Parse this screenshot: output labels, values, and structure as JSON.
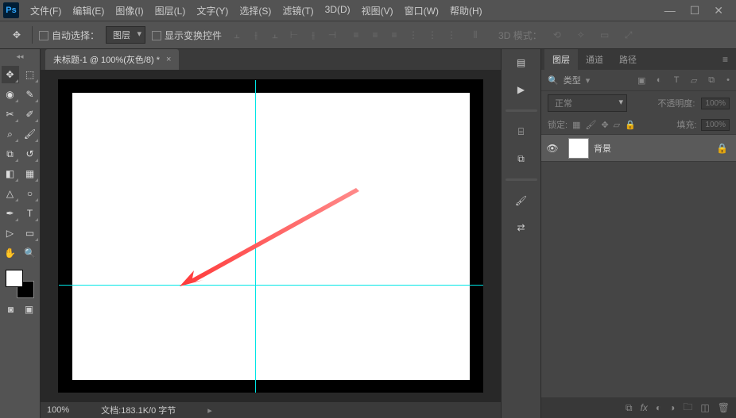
{
  "app": {
    "logo": "Ps"
  },
  "menu": [
    "文件(F)",
    "编辑(E)",
    "图像(I)",
    "图层(L)",
    "文字(Y)",
    "选择(S)",
    "滤镜(T)",
    "3D(D)",
    "视图(V)",
    "窗口(W)",
    "帮助(H)"
  ],
  "options": {
    "auto_select": "自动选择：",
    "layer_dd": "图层",
    "show_transform": "显示变换控件",
    "mode_3d": "3D 模式："
  },
  "doc": {
    "tab": "未标题-1 @ 100%(灰色/8) *",
    "zoom": "100%",
    "docinfo": "文档:183.1K/0 字节"
  },
  "panels": {
    "tabs": [
      "图层",
      "通道",
      "路径"
    ],
    "filter": "类型",
    "blend": "正常",
    "opacity_label": "不透明度:",
    "opacity": "100%",
    "lock_label": "锁定:",
    "fill_label": "填充:",
    "fill": "100%",
    "layer_name": "背景"
  }
}
